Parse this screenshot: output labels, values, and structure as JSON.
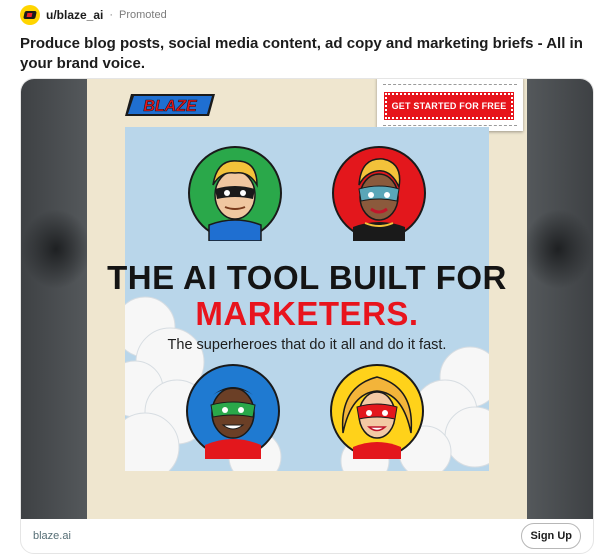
{
  "header": {
    "username": "u/blaze_ai",
    "separator": "·",
    "promoted_label": "Promoted"
  },
  "post": {
    "title": "Produce blog posts, social media content, ad copy and marketing briefs - All in your brand voice."
  },
  "ad": {
    "logo_text": "BLAZE",
    "cta_label": "GET STARTED FOR FREE",
    "headline_line1": "THE AI TOOL BUILT FOR",
    "headline_line2": "MARKETERS.",
    "subline": "The superheroes that do it all and do it fast.",
    "domain": "blaze.ai",
    "signup_label": "Sign Up",
    "colors": {
      "brand_red": "#e8141d",
      "sky": "#b9d6ea",
      "cream": "#efe6cf",
      "hero_green": "#2aa84a",
      "hero_red": "#e3171c",
      "hero_blue": "#1f7ad1",
      "hero_yellow": "#ffd21a"
    }
  }
}
